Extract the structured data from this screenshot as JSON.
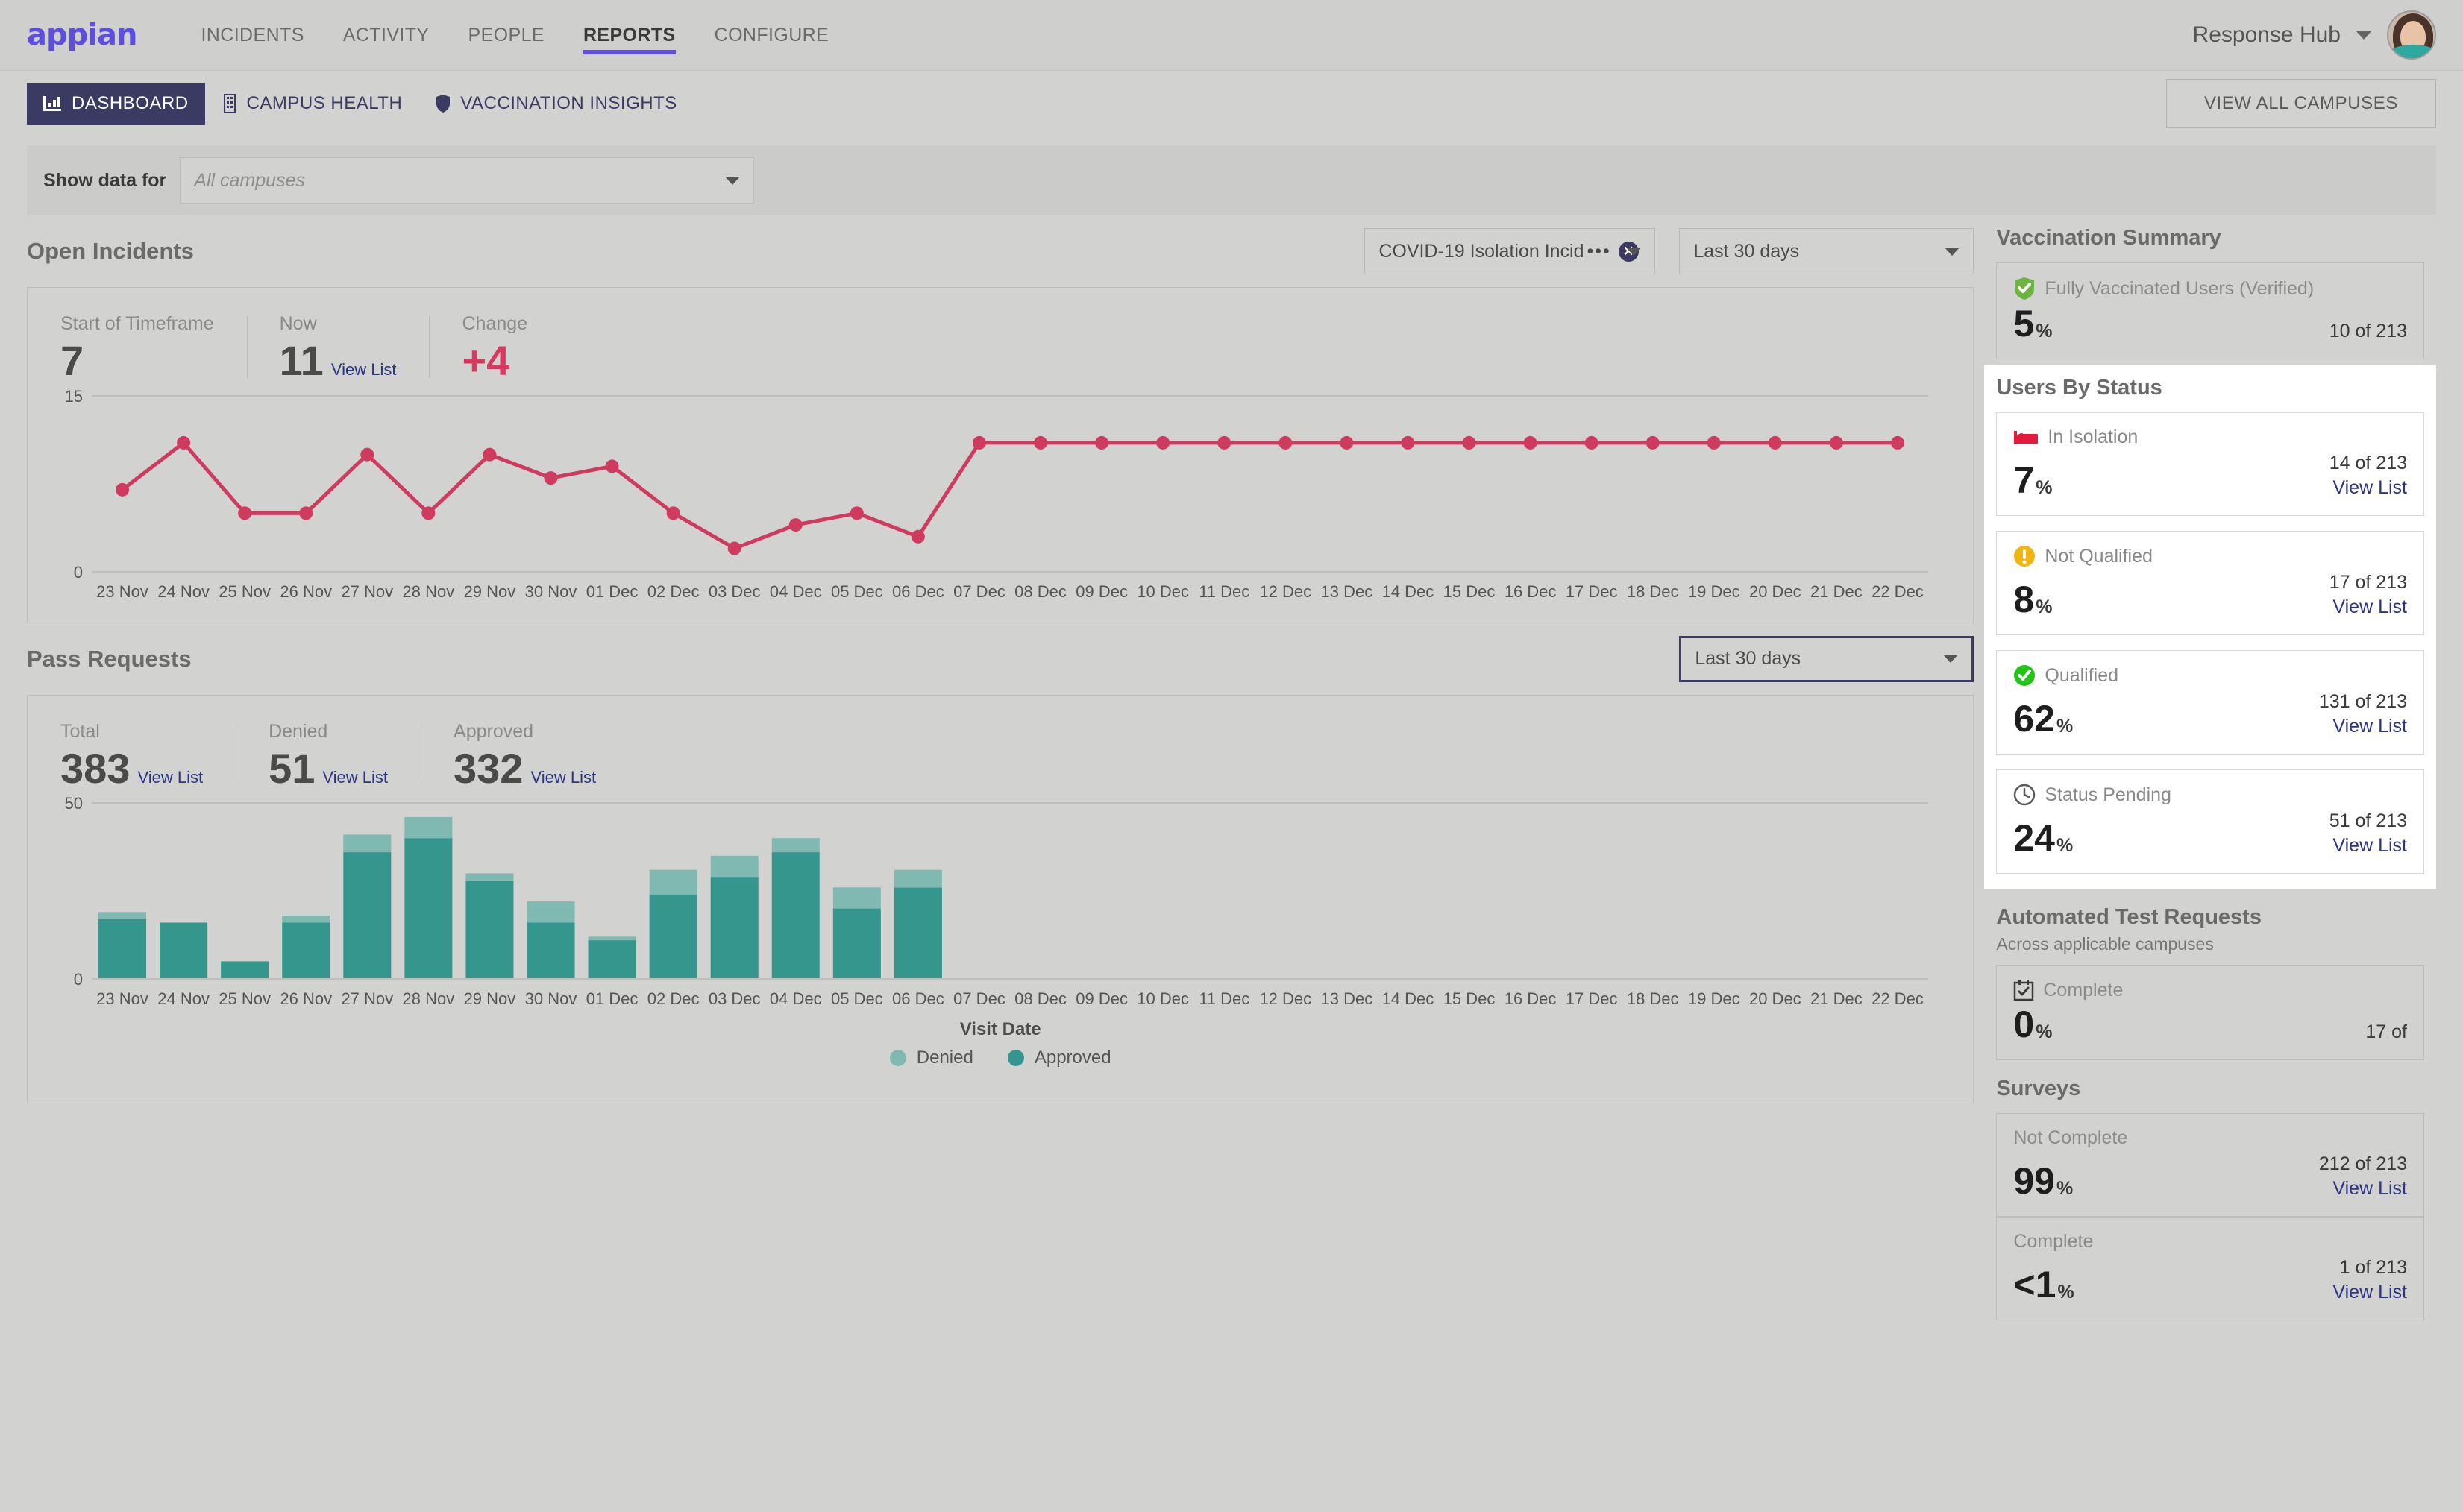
{
  "topnav": {
    "logo": "appian",
    "items": [
      {
        "label": "INCIDENTS",
        "active": false
      },
      {
        "label": "ACTIVITY",
        "active": false
      },
      {
        "label": "PEOPLE",
        "active": false
      },
      {
        "label": "REPORTS",
        "active": true
      },
      {
        "label": "CONFIGURE",
        "active": false
      }
    ],
    "hub_name": "Response Hub"
  },
  "tabbar": {
    "tabs": [
      {
        "label": "DASHBOARD",
        "icon": "bar-chart-icon",
        "active": true
      },
      {
        "label": "CAMPUS HEALTH",
        "icon": "building-icon",
        "active": false
      },
      {
        "label": "VACCINATION INSIGHTS",
        "icon": "shield-icon",
        "active": false
      }
    ],
    "view_all_campuses": "VIEW ALL CAMPUSES"
  },
  "filter": {
    "label": "Show data for",
    "placeholder": "All campuses",
    "value": ""
  },
  "open_incidents": {
    "title": "Open Incidents",
    "incident_type_filter": "COVID-19 Isolation Incid",
    "incident_type_ellipsis": "•••",
    "timeframe_filter": "Last 30 days",
    "kpis": [
      {
        "label": "Start of Timeframe",
        "value": "7",
        "link": "",
        "accent": false
      },
      {
        "label": "Now",
        "value": "11",
        "link": "View List",
        "accent": false
      },
      {
        "label": "Change",
        "value": "+4",
        "link": "",
        "accent": true
      }
    ]
  },
  "pass_requests": {
    "title": "Pass Requests",
    "timeframe_filter": "Last 30 days",
    "kpis": [
      {
        "label": "Total",
        "value": "383",
        "link": "View List"
      },
      {
        "label": "Denied",
        "value": "51",
        "link": "View List"
      },
      {
        "label": "Approved",
        "value": "332",
        "link": "View List"
      }
    ]
  },
  "vaccination_summary": {
    "title": "Vaccination Summary",
    "cards": [
      {
        "icon": "shield-check-icon",
        "icon_color": "#6cb33f",
        "label": "Fully Vaccinated Users (Verified)",
        "value": "5",
        "unit": "%",
        "fraction": "10 of 213",
        "link": ""
      }
    ]
  },
  "users_by_status": {
    "title": "Users By Status",
    "cards": [
      {
        "icon": "bed-icon",
        "icon_color": "#e01b3c",
        "label": "In Isolation",
        "value": "7",
        "unit": "%",
        "fraction": "14 of 213",
        "link": "View List"
      },
      {
        "icon": "warning-icon",
        "icon_color": "#f2b411",
        "label": "Not Qualified",
        "value": "8",
        "unit": "%",
        "fraction": "17 of 213",
        "link": "View List"
      },
      {
        "icon": "check-circle-icon",
        "icon_color": "#22c516",
        "label": "Qualified",
        "value": "62",
        "unit": "%",
        "fraction": "131 of 213",
        "link": "View List"
      },
      {
        "icon": "clock-icon",
        "icon_color": "#5a5a5a",
        "label": "Status Pending",
        "value": "24",
        "unit": "%",
        "fraction": "51 of 213",
        "link": "View List"
      }
    ]
  },
  "automated_test_requests": {
    "title": "Automated Test Requests",
    "subtitle": "Across applicable campuses",
    "cards": [
      {
        "icon": "calendar-check-icon",
        "icon_color": "#3a3a3a",
        "label": "Complete",
        "value": "0",
        "unit": "%",
        "fraction": "17 of",
        "link": ""
      }
    ]
  },
  "surveys": {
    "title": "Surveys",
    "cards": [
      {
        "icon": "",
        "icon_color": "",
        "label": "Not Complete",
        "value": "99",
        "unit": "%",
        "fraction": "212 of 213",
        "link": "View List"
      },
      {
        "icon": "",
        "icon_color": "",
        "label": "Complete",
        "value": "<1",
        "unit": "%",
        "fraction": "1 of 213",
        "link": "View List"
      }
    ]
  },
  "colors": {
    "brand_purple": "#5b4ee0",
    "tab_navy": "#3b3a63",
    "line_pink": "#cf3b5e",
    "bar_approved": "#34968c",
    "bar_denied": "#7fb9b1",
    "link_blue": "#2c3583",
    "page_bg": "#d2d2d0"
  },
  "chart_data": [
    {
      "type": "line",
      "title": "Open Incidents",
      "xlabel": "",
      "ylabel": "",
      "ylim": [
        0,
        15
      ],
      "yticks": [
        0,
        15
      ],
      "grid": true,
      "legend": null,
      "series_color": "#cf3b5e",
      "categories": [
        "23 Nov",
        "24 Nov",
        "25 Nov",
        "26 Nov",
        "27 Nov",
        "28 Nov",
        "29 Nov",
        "30 Nov",
        "01 Dec",
        "02 Dec",
        "03 Dec",
        "04 Dec",
        "05 Dec",
        "06 Dec",
        "07 Dec",
        "08 Dec",
        "09 Dec",
        "10 Dec",
        "11 Dec",
        "12 Dec",
        "13 Dec",
        "14 Dec",
        "15 Dec",
        "16 Dec",
        "17 Dec",
        "18 Dec",
        "19 Dec",
        "20 Dec",
        "21 Dec",
        "22 Dec"
      ],
      "values": [
        7,
        11,
        5,
        5,
        10,
        5,
        10,
        8,
        9,
        5,
        2,
        4,
        5,
        3,
        11,
        11,
        11,
        11,
        11,
        11,
        11,
        11,
        11,
        11,
        11,
        11,
        11,
        11,
        11,
        11
      ]
    },
    {
      "type": "bar",
      "title": "Pass Requests",
      "stacked": true,
      "xlabel": "Visit Date",
      "ylabel": "",
      "ylim": [
        0,
        50
      ],
      "yticks": [
        0,
        50
      ],
      "grid": true,
      "legend_position": "bottom",
      "categories": [
        "23 Nov",
        "24 Nov",
        "25 Nov",
        "26 Nov",
        "27 Nov",
        "28 Nov",
        "29 Nov",
        "30 Nov",
        "01 Dec",
        "02 Dec",
        "03 Dec",
        "04 Dec",
        "05 Dec",
        "06 Dec",
        "07 Dec",
        "08 Dec",
        "09 Dec",
        "10 Dec",
        "11 Dec",
        "12 Dec",
        "13 Dec",
        "14 Dec",
        "15 Dec",
        "16 Dec",
        "17 Dec",
        "18 Dec",
        "19 Dec",
        "20 Dec",
        "21 Dec",
        "22 Dec"
      ],
      "series": [
        {
          "name": "Approved",
          "color": "#34968c",
          "values": [
            17,
            16,
            5,
            16,
            36,
            40,
            28,
            16,
            11,
            24,
            29,
            36,
            20,
            26,
            0,
            0,
            0,
            0,
            0,
            0,
            0,
            0,
            0,
            0,
            0,
            0,
            0,
            0,
            0,
            0
          ]
        },
        {
          "name": "Denied",
          "color": "#7fb9b1",
          "values": [
            2,
            0,
            0,
            2,
            5,
            6,
            2,
            6,
            1,
            7,
            6,
            4,
            6,
            5,
            0,
            0,
            0,
            0,
            0,
            0,
            0,
            0,
            0,
            0,
            0,
            0,
            0,
            0,
            0,
            0
          ]
        }
      ]
    }
  ]
}
